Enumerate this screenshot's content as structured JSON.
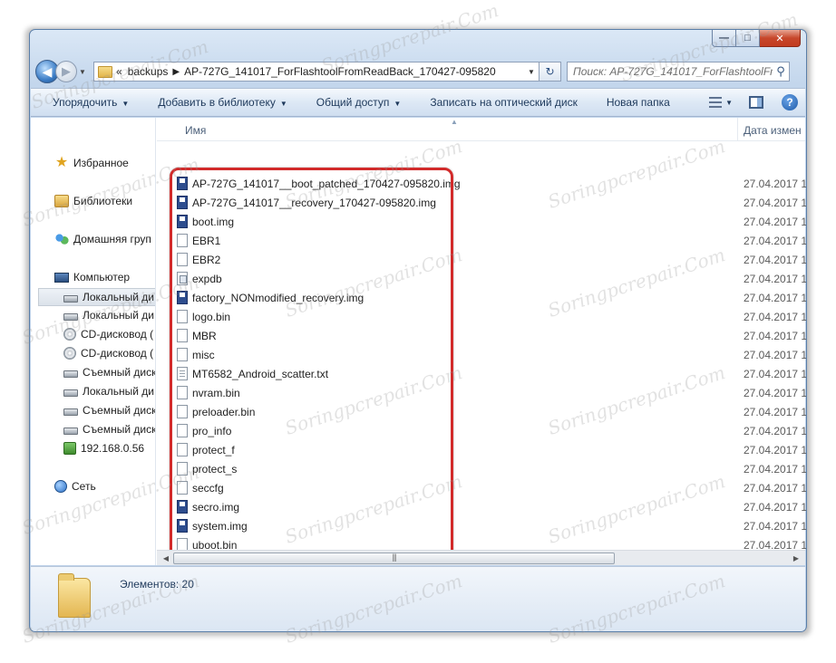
{
  "window": {
    "caption_buttons": {
      "minimize": "—",
      "maximize": "□",
      "close": "✕"
    }
  },
  "address": {
    "overflow": "«",
    "crumbs": [
      "backups",
      "AP-727G_141017_ForFlashtoolFromReadBack_170427-095820"
    ],
    "search_placeholder": "Поиск: AP-727G_141017_ForFlashtoolFr..."
  },
  "toolbar": {
    "organize": "Упорядочить",
    "add_library": "Добавить в библиотеку",
    "share": "Общий доступ",
    "burn": "Записать на оптический диск",
    "new_folder": "Новая папка"
  },
  "nav": {
    "favorites": "Избранное",
    "libraries": "Библиотеки",
    "homegroup": "Домашняя груп",
    "computer": "Компьютер",
    "drives": [
      {
        "label": "Локальный ди",
        "icon": "local-disk-icon"
      },
      {
        "label": "Локальный ди",
        "icon": "local-disk-icon"
      },
      {
        "label": "CD-дисковод (",
        "icon": "cd-drive-icon"
      },
      {
        "label": "CD-дисковод (",
        "icon": "cd-drive-icon"
      },
      {
        "label": "Съемный диск",
        "icon": "removable-disk-icon"
      },
      {
        "label": "Локальный ди",
        "icon": "local-disk-icon"
      },
      {
        "label": "Съемный диск",
        "icon": "removable-disk-icon"
      },
      {
        "label": "Съемный диск",
        "icon": "removable-disk-icon"
      },
      {
        "label": "192.168.0.56",
        "icon": "network-share-icon"
      }
    ],
    "network": "Сеть"
  },
  "columns": {
    "name": "Имя",
    "date": "Дата измен"
  },
  "files": [
    {
      "name": "AP-727G_141017__boot_patched_170427-095820.img",
      "type": "img",
      "date": "27.04.2017 1"
    },
    {
      "name": "AP-727G_141017__recovery_170427-095820.img",
      "type": "img",
      "date": "27.04.2017 1"
    },
    {
      "name": "boot.img",
      "type": "img",
      "date": "27.04.2017 1"
    },
    {
      "name": "EBR1",
      "type": "doc",
      "date": "27.04.2017 1"
    },
    {
      "name": "EBR2",
      "type": "doc",
      "date": "27.04.2017 1"
    },
    {
      "name": "expdb",
      "type": "exe",
      "date": "27.04.2017 1"
    },
    {
      "name": "factory_NONmodified_recovery.img",
      "type": "img",
      "date": "27.04.2017 1"
    },
    {
      "name": "logo.bin",
      "type": "doc",
      "date": "27.04.2017 1"
    },
    {
      "name": "MBR",
      "type": "doc",
      "date": "27.04.2017 1"
    },
    {
      "name": "misc",
      "type": "doc",
      "date": "27.04.2017 1"
    },
    {
      "name": "MT6582_Android_scatter.txt",
      "type": "txt",
      "date": "27.04.2017 1"
    },
    {
      "name": "nvram.bin",
      "type": "doc",
      "date": "27.04.2017 1"
    },
    {
      "name": "preloader.bin",
      "type": "doc",
      "date": "27.04.2017 1"
    },
    {
      "name": "pro_info",
      "type": "doc",
      "date": "27.04.2017 1"
    },
    {
      "name": "protect_f",
      "type": "doc",
      "date": "27.04.2017 1"
    },
    {
      "name": "protect_s",
      "type": "doc",
      "date": "27.04.2017 1"
    },
    {
      "name": "seccfg",
      "type": "doc",
      "date": "27.04.2017 1"
    },
    {
      "name": "secro.img",
      "type": "img",
      "date": "27.04.2017 1"
    },
    {
      "name": "system.img",
      "type": "img",
      "date": "27.04.2017 1"
    },
    {
      "name": "uboot.bin",
      "type": "doc",
      "date": "27.04.2017 1"
    }
  ],
  "details": {
    "items_count": "Элементов: 20"
  },
  "watermark": "Soringpcrepair.Com",
  "colors": {
    "highlight": "#d22a2a",
    "title_bar": "#c3d6ec",
    "link": "#1e395b"
  }
}
